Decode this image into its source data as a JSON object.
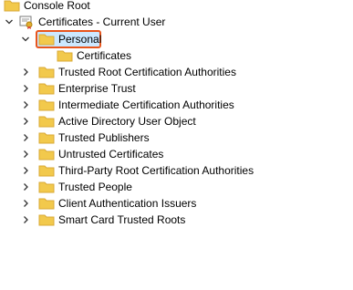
{
  "tree": {
    "root": {
      "label": "Console Root"
    },
    "snapin": {
      "label": "Certificates - Current User"
    },
    "personal": {
      "label": "Personal",
      "selected": true
    },
    "personal_child": {
      "label": "Certificates"
    },
    "stores": [
      {
        "label": "Trusted Root Certification Authorities"
      },
      {
        "label": "Enterprise Trust"
      },
      {
        "label": "Intermediate Certification Authorities"
      },
      {
        "label": "Active Directory User Object"
      },
      {
        "label": "Trusted Publishers"
      },
      {
        "label": "Untrusted Certificates"
      },
      {
        "label": "Third-Party Root Certification Authorities"
      },
      {
        "label": "Trusted People"
      },
      {
        "label": "Client Authentication Issuers"
      },
      {
        "label": "Smart Card Trusted Roots"
      }
    ]
  },
  "colors": {
    "folder": "#f2c94c",
    "folder_dark": "#d9a935",
    "highlight_border": "#e8551c",
    "selection_fill": "#cce8ff"
  },
  "icons": {
    "expand": "chevron-right-icon",
    "collapse": "chevron-down-icon",
    "folder": "folder-icon",
    "snapin": "certificates-snapin-icon"
  }
}
